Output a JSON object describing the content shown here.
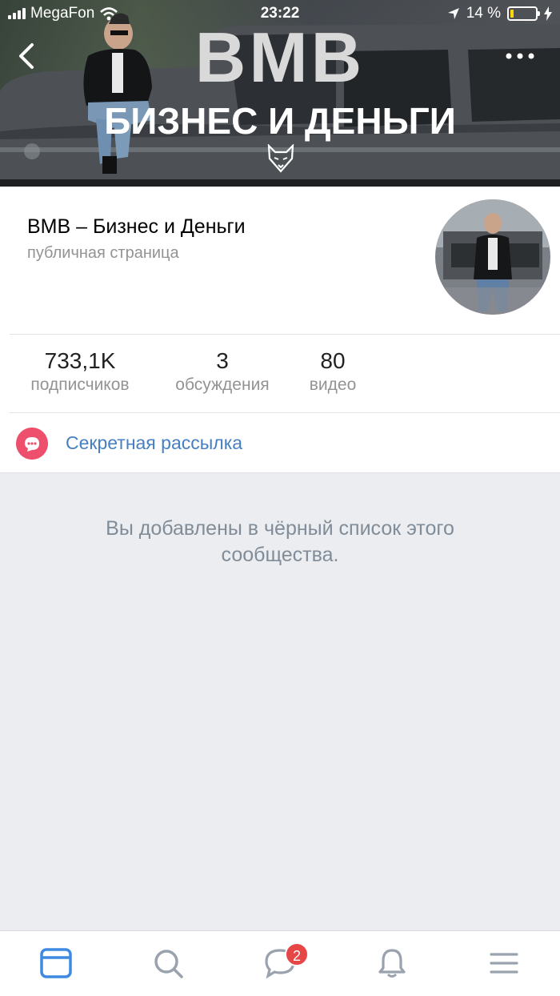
{
  "status_bar": {
    "carrier": "MegaFon",
    "time": "23:22",
    "battery_percent": "14 %",
    "battery_level": 0.14
  },
  "cover": {
    "logo": "ВМВ",
    "title": "БИЗНЕС И ДЕНЬГИ"
  },
  "group": {
    "name": "ВМВ – Бизнес и Деньги",
    "type": "публичная страница"
  },
  "counters": [
    {
      "value": "733,1K",
      "label": "подписчиков"
    },
    {
      "value": "3",
      "label": "обсуждения"
    },
    {
      "value": "80",
      "label": "видео"
    }
  ],
  "newsletter": {
    "label": "Секретная рассылка"
  },
  "blacklist_message": "Вы добавлены в чёрный список этого сообщества.",
  "tabbar": {
    "items": [
      "feed-icon",
      "search-icon",
      "messages-icon",
      "notifications-icon",
      "menu-icon"
    ],
    "messages_badge": "2"
  },
  "colors": {
    "accent": "#4680c2",
    "newsletter_icon": "#ee4f6c",
    "badge": "#e64646",
    "tab_active": "#3f8ae0",
    "tab_inactive": "#99a2ad",
    "battery": "#ffd60a"
  }
}
